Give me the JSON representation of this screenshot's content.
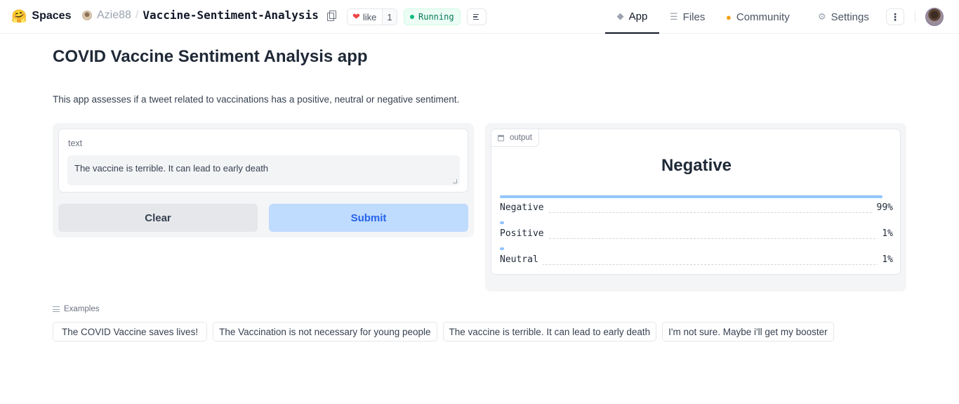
{
  "header": {
    "brand": "Spaces",
    "brand_icon": "hugging-face-emoji",
    "owner": "Azie88",
    "separator": "/",
    "repo": "Vaccine-Sentiment-Analysis",
    "like_label": "like",
    "like_count": "1",
    "status": "Running",
    "status_color": "#10b981",
    "tabs": [
      {
        "label": "App",
        "icon": "cube-icon",
        "active": true
      },
      {
        "label": "Files",
        "icon": "files-icon",
        "active": false
      },
      {
        "label": "Community",
        "icon": "community-icon",
        "active": false
      },
      {
        "label": "Settings",
        "icon": "gear-icon",
        "active": false
      }
    ]
  },
  "app": {
    "title": "COVID Vaccine Sentiment Analysis app",
    "description": "This app assesses if a tweet related to vaccinations has a positive, neutral or negative sentiment.",
    "input": {
      "label": "text",
      "value": "The vaccine is terrible. It can lead to early death"
    },
    "buttons": {
      "clear": "Clear",
      "submit": "Submit"
    },
    "output": {
      "tag": "output",
      "label": "Negative",
      "confidences": [
        {
          "name": "Negative",
          "value_text": "99%",
          "value": 0.99
        },
        {
          "name": "Positive",
          "value_text": "1%",
          "value": 0.01
        },
        {
          "name": "Neutral",
          "value_text": "1%",
          "value": 0.01
        }
      ],
      "bar_color": "#93c5fd"
    },
    "examples": {
      "heading": "Examples",
      "items": [
        "The COVID Vaccine saves lives!",
        "The Vaccination is not necessary for young people",
        "The vaccine is terrible. It can lead to early death",
        "I'm not sure. Maybe i'll get my booster"
      ]
    }
  }
}
